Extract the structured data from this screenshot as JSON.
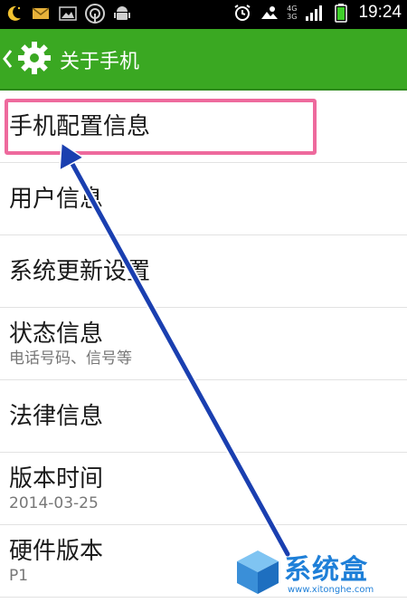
{
  "status_bar": {
    "time": "19:24",
    "network_top": "4G",
    "network_bottom": "3G",
    "icons": [
      "moon-icon",
      "mail-icon",
      "image-icon",
      "wifi-icon",
      "android-icon",
      "alarm-icon",
      "weather-icon",
      "signal-icon",
      "battery-icon"
    ]
  },
  "action_bar": {
    "title": "关于手机",
    "icon": "gear-icon"
  },
  "list": {
    "items": [
      {
        "title": "手机配置信息",
        "subtitle": ""
      },
      {
        "title": "用户信息",
        "subtitle": ""
      },
      {
        "title": "系统更新设置",
        "subtitle": ""
      },
      {
        "title": "状态信息",
        "subtitle": "电话号码、信号等"
      },
      {
        "title": "法律信息",
        "subtitle": ""
      },
      {
        "title": "版本时间",
        "subtitle": "2014-03-25"
      },
      {
        "title": "硬件版本",
        "subtitle": "P1"
      }
    ]
  },
  "watermark": {
    "brand": "系统盒",
    "url": "www.xitonghe.com"
  },
  "colors": {
    "action_bar": "#3aa822",
    "highlight": "#ee6a9d",
    "arrow": "#1a3fb0"
  }
}
